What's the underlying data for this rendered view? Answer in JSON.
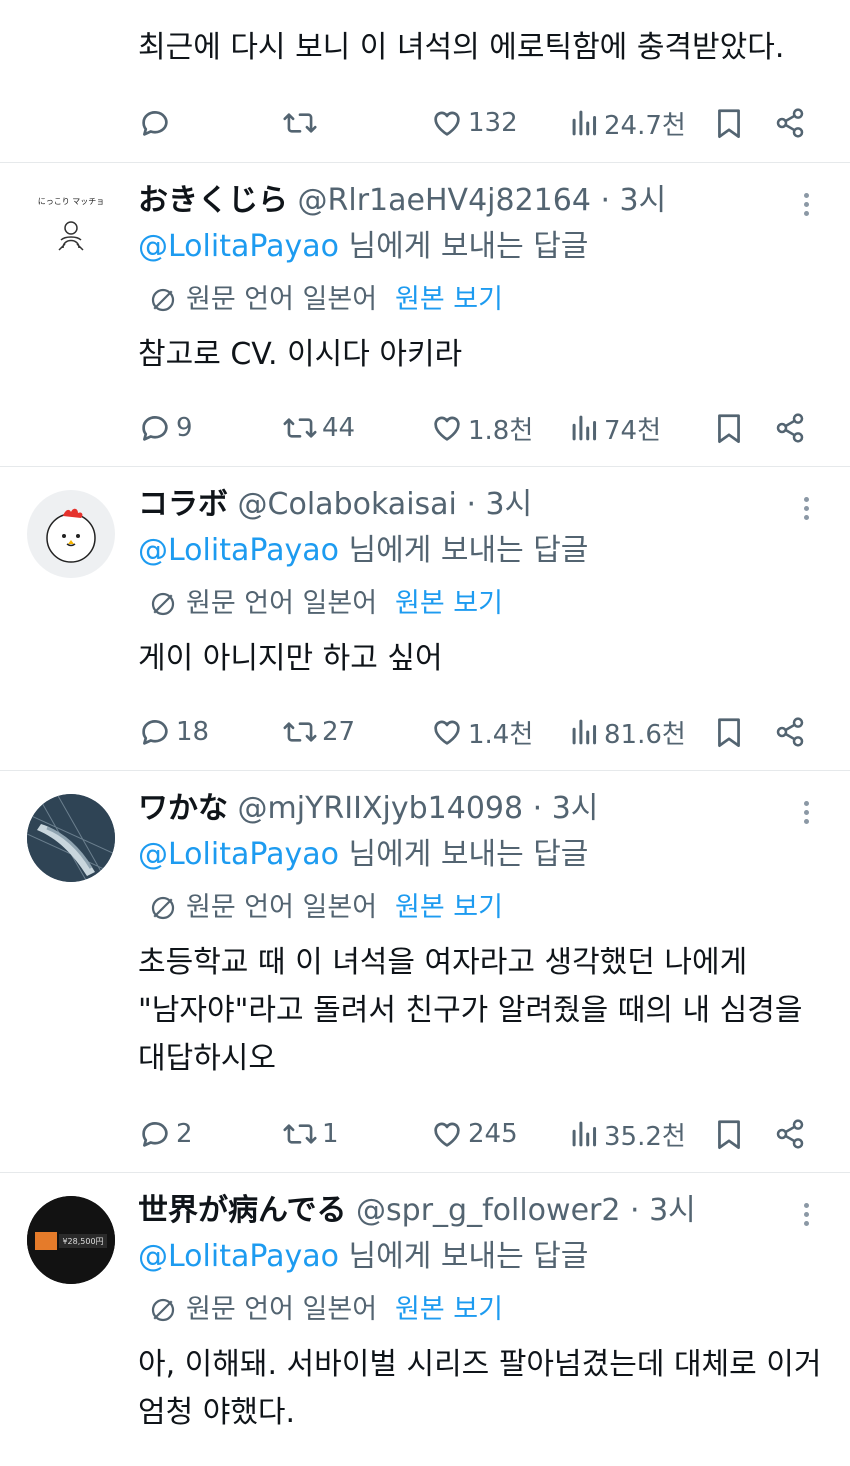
{
  "reply_prefix_suffix": "님에게 보내는 답글",
  "translate_label": "원문 언어 일본어",
  "translate_show": "원본 보기",
  "top_tweet": {
    "text": "최근에 다시 보니 이 녀석의 에로틱함에 충격받았다.",
    "replies": "",
    "retweets": "",
    "likes": "132",
    "views": "24.7천"
  },
  "tweets": [
    {
      "name": "おきくじら",
      "handle": "@Rlr1aeHV4j82164",
      "time": "· 3시",
      "mention": "@LolitaPayao",
      "lines": [
        "참고로 CV. 이시다 아키라"
      ],
      "replies": "9",
      "retweets": "44",
      "likes": "1.8천",
      "views": "74천",
      "avatar_text": "にっこり マッチョ"
    },
    {
      "name": "コラボ",
      "handle": "@Colabokaisai",
      "time": "· 3시",
      "mention": "@LolitaPayao",
      "lines": [
        "게이 아니지만 하고 싶어"
      ],
      "replies": "18",
      "retweets": "27",
      "likes": "1.4천",
      "views": "81.6천"
    },
    {
      "name": "ワかな",
      "handle": "@mjYRIIXjyb14098",
      "time": "· 3시",
      "mention": "@LolitaPayao",
      "lines": [
        "초등학교 때 이 녀석을 여자라고 생각했던 나에게",
        "\"남자야\"라고 돌려서 친구가 알려줬을 때의 내 심경을",
        "대답하시오"
      ],
      "replies": "2",
      "retweets": "1",
      "likes": "245",
      "views": "35.2천"
    },
    {
      "name": "世界が病んでる",
      "handle": "@spr_g_follower2",
      "time": "· 3시",
      "mention": "@LolitaPayao",
      "lines": [
        "아, 이해돼. 서바이벌 시리즈 팔아넘겼는데 대체로 이거",
        "엄청 야했다."
      ],
      "avatar_text": "¥28,500円"
    }
  ],
  "colors": {
    "link": "#1d9bf0",
    "muted": "#536471",
    "text": "#0f1419",
    "divider": "#e6e9eb"
  }
}
